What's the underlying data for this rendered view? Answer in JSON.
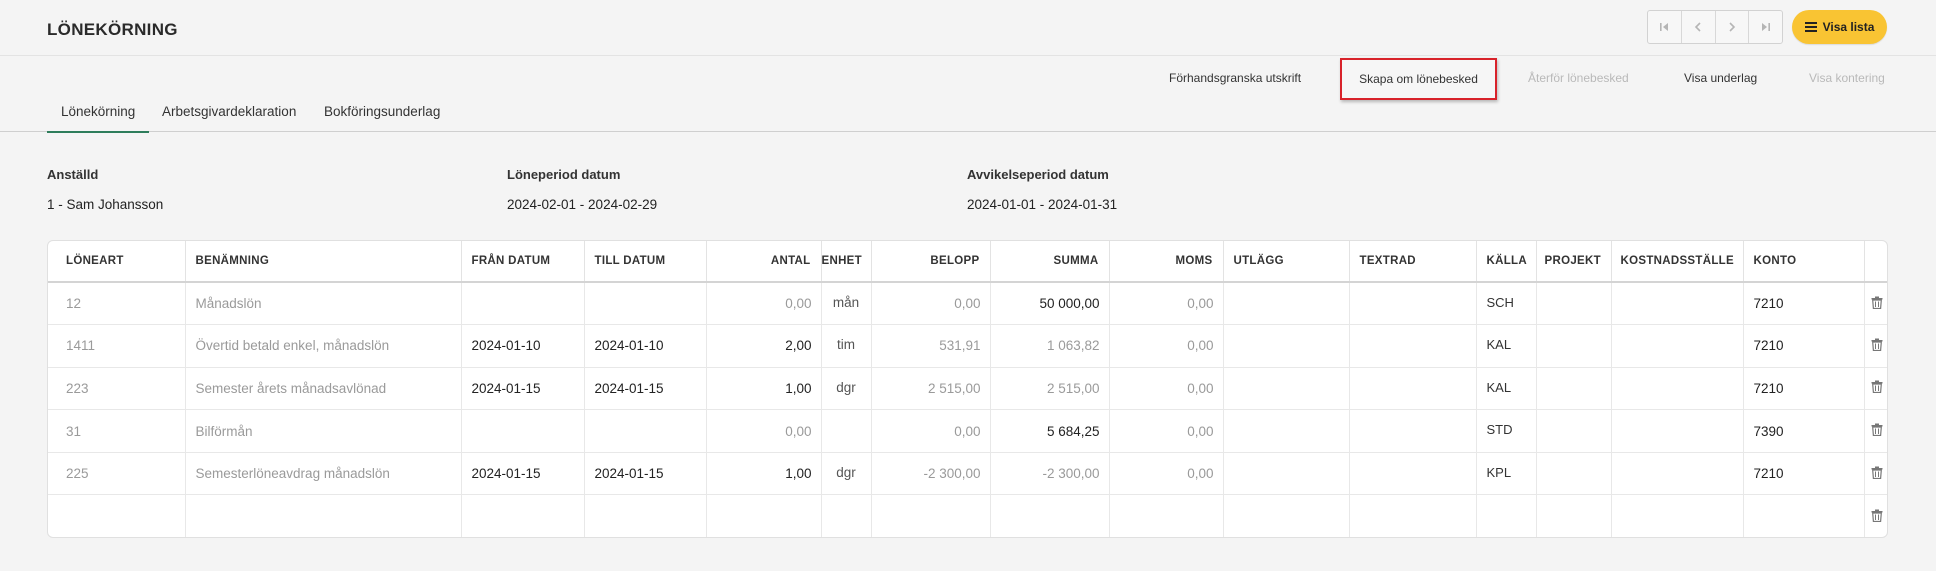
{
  "page_title": "LÖNEKÖRNING",
  "toolbar": {
    "visa_lista_label": "Visa lista"
  },
  "actions": [
    {
      "label": "Förhandsgranska utskrift",
      "enabled": true
    },
    {
      "label": "Skapa om lönebesked",
      "enabled": true,
      "highlighted": true
    },
    {
      "label": "Återför lönebesked",
      "enabled": false
    },
    {
      "label": "Visa underlag",
      "enabled": true
    },
    {
      "label": "Visa kontering",
      "enabled": false
    }
  ],
  "tabs": [
    {
      "label": "Lönekörning",
      "active": true
    },
    {
      "label": "Arbetsgivardeklaration",
      "active": false
    },
    {
      "label": "Bokföringsunderlag",
      "active": false
    }
  ],
  "info": {
    "employee_label": "Anställd",
    "employee_value": "1 - Sam Johansson",
    "period_label": "Löneperiod datum",
    "period_value": "2024-02-01 - 2024-02-29",
    "deviation_label": "Avvikelseperiod datum",
    "deviation_value": "2024-01-01 - 2024-01-31"
  },
  "table": {
    "columns": [
      "LÖNEART",
      "BENÄMNING",
      "FRÅN DATUM",
      "TILL DATUM",
      "ANTAL",
      "ENHET",
      "BELOPP",
      "SUMMA",
      "MOMS",
      "UTLÄGG",
      "TEXTRAD",
      "KÄLLA",
      "PROJEKT",
      "KOSTNADSSTÄLLE",
      "KONTO"
    ],
    "rows": [
      {
        "loneart": "12",
        "benamning": "Månadslön",
        "fran": "",
        "till": "",
        "antal": "0,00",
        "enhet": "mån",
        "belopp": "0,00",
        "summa": "50 000,00",
        "moms": "0,00",
        "utlagg": "",
        "textrad": "",
        "kalla": "SCH",
        "projekt": "",
        "kostnadsstalle": "",
        "konto": "7210"
      },
      {
        "loneart": "1411",
        "benamning": "Övertid betald enkel, månadslön",
        "fran": "2024-01-10",
        "till": "2024-01-10",
        "antal": "2,00",
        "enhet": "tim",
        "belopp": "531,91",
        "summa": "1 063,82",
        "moms": "0,00",
        "utlagg": "",
        "textrad": "",
        "kalla": "KAL",
        "projekt": "",
        "kostnadsstalle": "",
        "konto": "7210"
      },
      {
        "loneart": "223",
        "benamning": "Semester årets månadsavlönad",
        "fran": "2024-01-15",
        "till": "2024-01-15",
        "antal": "1,00",
        "enhet": "dgr",
        "belopp": "2 515,00",
        "summa": "2 515,00",
        "moms": "0,00",
        "utlagg": "",
        "textrad": "",
        "kalla": "KAL",
        "projekt": "",
        "kostnadsstalle": "",
        "konto": "7210"
      },
      {
        "loneart": "31",
        "benamning": "Bilförmån",
        "fran": "",
        "till": "",
        "antal": "0,00",
        "enhet": "",
        "belopp": "0,00",
        "summa": "5 684,25",
        "moms": "0,00",
        "utlagg": "",
        "textrad": "",
        "kalla": "STD",
        "projekt": "",
        "kostnadsstalle": "",
        "konto": "7390"
      },
      {
        "loneart": "225",
        "benamning": "Semesterlöneavdrag månadslön",
        "fran": "2024-01-15",
        "till": "2024-01-15",
        "antal": "1,00",
        "enhet": "dgr",
        "belopp": "-2 300,00",
        "summa": "-2 300,00",
        "moms": "0,00",
        "utlagg": "",
        "textrad": "",
        "kalla": "KPL",
        "projekt": "",
        "kostnadsstalle": "",
        "konto": "7210"
      },
      {
        "loneart": "",
        "benamning": "",
        "fran": "",
        "till": "",
        "antal": "",
        "enhet": "",
        "belopp": "",
        "summa": "",
        "moms": "",
        "utlagg": "",
        "textrad": "",
        "kalla": "",
        "projekt": "",
        "kostnadsstalle": "",
        "konto": ""
      }
    ]
  }
}
